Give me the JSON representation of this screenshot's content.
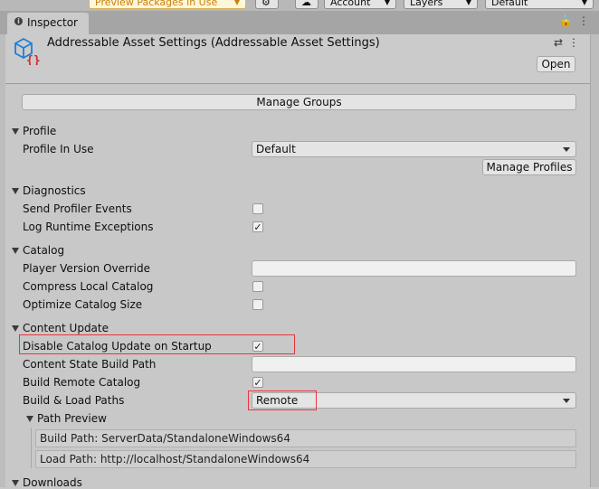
{
  "toolbar": {
    "preview_label": "Preview Packages in Use",
    "account_label": "Account",
    "layers_label": "Layers",
    "layout_label": "Default"
  },
  "tab": {
    "icon_glyph": "i",
    "label": "Inspector",
    "lock_glyph": "🔒",
    "menu_glyph": "⋮"
  },
  "header": {
    "title": "Addressable Asset Settings (Addressable Asset Settings)",
    "settings_glyph": "⇄",
    "more_glyph": "⋮",
    "open_label": "Open"
  },
  "manage_groups_label": "Manage Groups",
  "profile": {
    "section": "Profile",
    "in_use_label": "Profile In Use",
    "in_use_value": "Default",
    "manage_profiles_label": "Manage Profiles"
  },
  "diagnostics": {
    "section": "Diagnostics",
    "send_profiler_label": "Send Profiler Events",
    "send_profiler_checked": false,
    "log_exceptions_label": "Log Runtime Exceptions",
    "log_exceptions_checked": true
  },
  "catalog": {
    "section": "Catalog",
    "player_version_label": "Player Version Override",
    "player_version_value": "",
    "compress_label": "Compress Local Catalog",
    "compress_checked": false,
    "optimize_label": "Optimize Catalog Size",
    "optimize_checked": false
  },
  "content_update": {
    "section": "Content Update",
    "disable_update_label": "Disable Catalog Update on Startup",
    "disable_update_checked": true,
    "state_path_label": "Content State Build Path",
    "state_path_value": "",
    "build_remote_label": "Build Remote Catalog",
    "build_remote_checked": true,
    "paths_label": "Build & Load Paths",
    "paths_value": "Remote",
    "path_preview_section": "Path Preview",
    "build_path": "Build Path: ServerData/StandaloneWindows64",
    "load_path": "Load Path: http://localhost/StandaloneWindows64"
  },
  "downloads": {
    "section": "Downloads"
  },
  "check_glyph": "✓",
  "colors": {
    "highlight": "#e8363f",
    "icon_blue": "#1e7fd6",
    "icon_red": "#d22b2b",
    "preview_text": "#c9800a"
  }
}
